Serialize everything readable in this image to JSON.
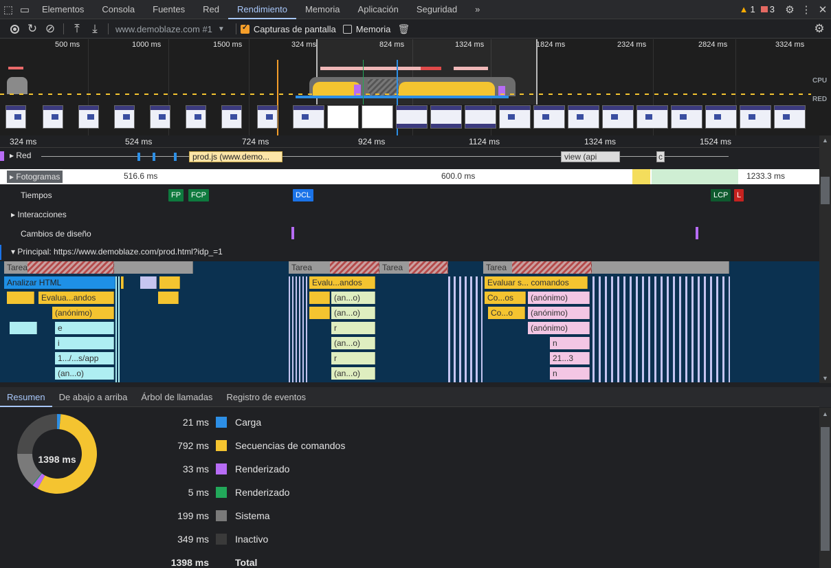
{
  "tabs": {
    "elements": "Elementos",
    "console": "Consola",
    "sources": "Fuentes",
    "network": "Red",
    "performance": "Rendimiento",
    "memory": "Memoria",
    "application": "Aplicación",
    "security": "Seguridad",
    "more": "»",
    "warnings": "1",
    "errors": "3"
  },
  "toolbar": {
    "profile_select": "www.demoblaze.com #1",
    "screenshots_label": "Capturas de pantalla",
    "memory_label": "Memoria"
  },
  "overview": {
    "ticks": [
      "500 ms",
      "1000 ms",
      "1500 ms",
      "324 ms",
      "824 ms",
      "1324 ms",
      "1824 ms",
      "2324 ms",
      "2824 ms",
      "3324 ms"
    ],
    "cpu_label": "CPU",
    "net_label": "RED"
  },
  "ruler": {
    "ticks": [
      "324 ms",
      "524 ms",
      "724 ms",
      "924 ms",
      "1124 ms",
      "1324 ms",
      "1524 ms"
    ]
  },
  "tracks": {
    "network": "Red",
    "network_req1": "prod.js (www.demo...",
    "network_req2": "view (api",
    "network_req3": "c",
    "frames": "Fotogramas",
    "frame1": "516.6 ms",
    "frame2": "600.0 ms",
    "frame3": "1233.3 ms",
    "timings": "Tiempos",
    "fp": "FP",
    "fcp": "FCP",
    "dcl": "DCL",
    "lcp": "LCP",
    "l": "L",
    "interactions": "Interacciones",
    "layout_shifts": "Cambios de diseño",
    "main": "Principal: https://www.demoblaze.com/prod.html?idp_=1"
  },
  "flame": {
    "task": "Tarea",
    "parse_html": "Analizar HTML",
    "evaluate_short": "Evalua...andos",
    "evaluate_short2": "Evalu...andos",
    "evaluate_long": "Evaluar s... comandos",
    "anon": "(anónimo)",
    "anon_short": "(an...o)",
    "co_os": "Co...os",
    "co_o": "Co...o",
    "e": "e",
    "i": "i",
    "r": "r",
    "n": "n",
    "app_path": "1.../...s/app",
    "n213": "21...3"
  },
  "bottom_tabs": [
    "Resumen",
    "De abajo a arriba",
    "Árbol de llamadas",
    "Registro de eventos"
  ],
  "summary": {
    "total_center": "1398 ms",
    "rows": [
      {
        "value": "21 ms",
        "label": "Carga",
        "color": "#2d8fe6"
      },
      {
        "value": "792 ms",
        "label": "Secuencias de comandos",
        "color": "#f4c430"
      },
      {
        "value": "33 ms",
        "label": "Renderizado",
        "color": "#b76cf5"
      },
      {
        "value": "5 ms",
        "label": "Renderizado",
        "color": "#22a85a"
      },
      {
        "value": "199 ms",
        "label": "Sistema",
        "color": "#7a7a7a"
      },
      {
        "value": "349 ms",
        "label": "Inactivo",
        "color": "#3a3a3a"
      },
      {
        "value": "1398 ms",
        "label": "Total",
        "color": "#202124"
      }
    ]
  },
  "colors": {
    "accent": "#a8c7fa",
    "scripting": "#f4c430",
    "loading": "#2d8fe6",
    "rendering": "#b76cf5",
    "painting": "#22a85a",
    "system": "#7a7a7a",
    "idle": "#3a3a3a"
  }
}
